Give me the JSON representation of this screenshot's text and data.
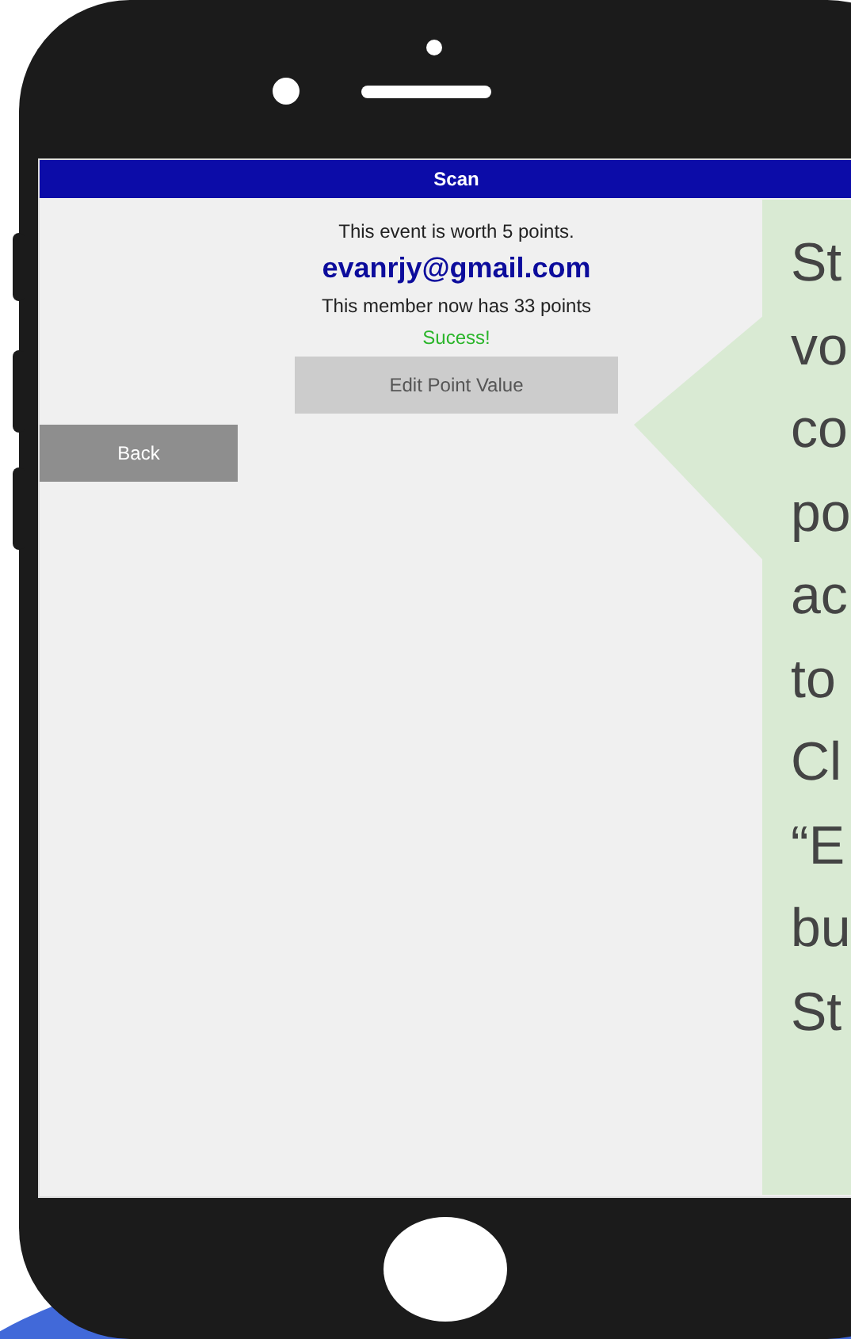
{
  "screen": {
    "header": {
      "title": "Scan"
    },
    "event_text": "This event is worth 5 points.",
    "member_email": "evanrjy@gmail.com",
    "points_text": "This member now has 33 points",
    "status_text": "Sucess!",
    "edit_button": "Edit Point Value",
    "back_button": "Back"
  },
  "callout": {
    "lines": [
      "St",
      "vo",
      "co",
      "po",
      "ac",
      "to",
      "Cl",
      "“E",
      "bu",
      "St"
    ]
  }
}
